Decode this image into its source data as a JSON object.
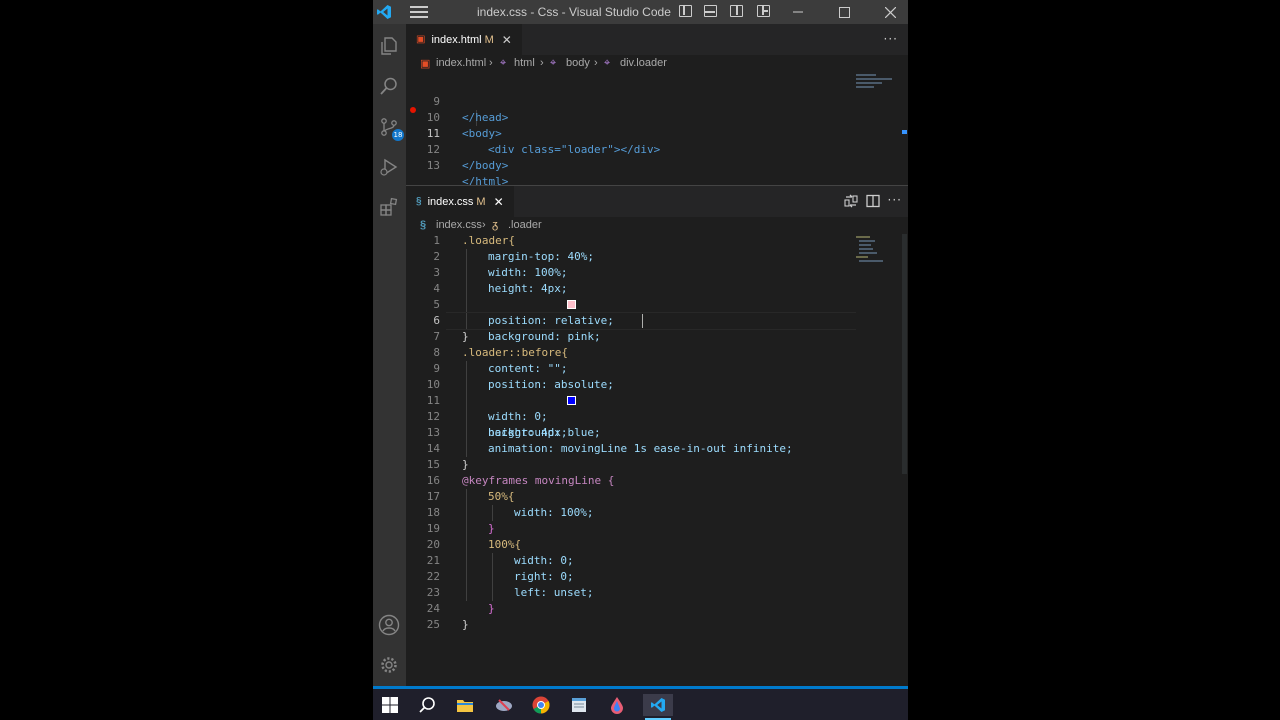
{
  "window": {
    "title": "index.css - Css - Visual Studio Code"
  },
  "activity_bar": {
    "source_control_badge": "18"
  },
  "top_editor": {
    "tab": {
      "label": "index.html",
      "modified": "M"
    },
    "breadcrumb": [
      "index.html",
      "html",
      "body",
      "div.loader"
    ],
    "lines": [
      {
        "num": "9",
        "text": "</head>"
      },
      {
        "num": "10",
        "text": "<body>"
      },
      {
        "num": "11",
        "text": "<div class=\"loader\"></div>"
      },
      {
        "num": "12",
        "text": "</body>"
      },
      {
        "num": "13",
        "text": "</html>"
      }
    ]
  },
  "bottom_editor": {
    "tab": {
      "label": "index.css",
      "modified": "M"
    },
    "breadcrumb": [
      "index.css",
      ".loader"
    ],
    "lines": [
      {
        "num": "1",
        "text": ".loader{"
      },
      {
        "num": "2",
        "text": "margin-top: 40%;"
      },
      {
        "num": "3",
        "text": "width: 100%;"
      },
      {
        "num": "4",
        "text": "height: 4px;"
      },
      {
        "num": "5",
        "text": "background: pink;"
      },
      {
        "num": "6",
        "text": "position: relative;"
      },
      {
        "num": "7",
        "text": "}"
      },
      {
        "num": "8",
        "text": ".loader::before{"
      },
      {
        "num": "9",
        "text": "content: \"\";"
      },
      {
        "num": "10",
        "text": "position: absolute;"
      },
      {
        "num": "11",
        "text": "background: blue;"
      },
      {
        "num": "12",
        "text": "width: 0;"
      },
      {
        "num": "13",
        "text": "height: 4px;"
      },
      {
        "num": "14",
        "text": "animation: movingLine 1s ease-in-out infinite;"
      },
      {
        "num": "15",
        "text": "}"
      },
      {
        "num": "16",
        "text": "@keyframes movingLine {"
      },
      {
        "num": "17",
        "text": "50%{"
      },
      {
        "num": "18",
        "text": "width: 100%;"
      },
      {
        "num": "19",
        "text": "}"
      },
      {
        "num": "20",
        "text": "100%{"
      },
      {
        "num": "21",
        "text": "width: 0;"
      },
      {
        "num": "22",
        "text": "right: 0;"
      },
      {
        "num": "23",
        "text": "left: unset;"
      },
      {
        "num": "24",
        "text": "}"
      },
      {
        "num": "25",
        "text": "}"
      }
    ]
  },
  "colors": {
    "accent": "#007acc",
    "swatch_pink": "#ffc0cb",
    "swatch_blue": "#0000ff",
    "breakpoint": "#e51400"
  },
  "icons": {
    "app": "vscode-logo-icon",
    "activity": [
      "explorer-icon",
      "search-icon",
      "source-control-icon",
      "run-debug-icon",
      "extensions-icon",
      "accounts-icon",
      "settings-gear-icon"
    ],
    "taskbar": [
      "windows-start-icon",
      "search-icon",
      "file-explorer-icon",
      "snip-icon",
      "chrome-icon",
      "notepad-icon",
      "drop-icon",
      "vscode-icon"
    ]
  }
}
